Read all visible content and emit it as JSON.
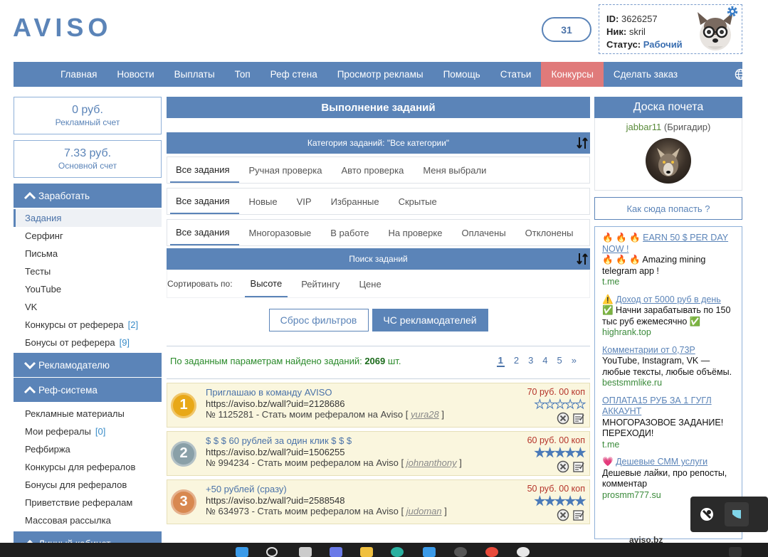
{
  "header": {
    "logo": "AVISO",
    "counter": "31"
  },
  "user": {
    "id_label": "ID:",
    "id": "3626257",
    "nick_label": "Ник:",
    "nick": "skril",
    "status_label": "Статус:",
    "status": "Рабочий"
  },
  "nav": {
    "items": [
      "Главная",
      "Новости",
      "Выплаты",
      "Топ",
      "Реф стена",
      "Просмотр рекламы",
      "Помощь",
      "Статьи",
      "Конкурсы",
      "Сделать заказ"
    ],
    "active": "Конкурсы",
    "active_color": "#e07a7a"
  },
  "accounts": [
    {
      "amount": "0 руб.",
      "label": "Рекламный счет"
    },
    {
      "amount": "7.33 руб.",
      "label": "Основной счет"
    }
  ],
  "sidebar": {
    "earn_title": "Заработать",
    "earn_items": [
      {
        "label": "Задания",
        "count": ""
      },
      {
        "label": "Серфинг",
        "count": ""
      },
      {
        "label": "Письма",
        "count": ""
      },
      {
        "label": "Тесты",
        "count": ""
      },
      {
        "label": "YouTube",
        "count": ""
      },
      {
        "label": "VK",
        "count": ""
      },
      {
        "label": "Конкурсы от реферера",
        "count": "[2]"
      },
      {
        "label": "Бонусы от реферера",
        "count": "[9]"
      }
    ],
    "advertiser_title": "Рекламодателю",
    "ref_title": "Реф-система",
    "ref_items": [
      {
        "label": "Рекламные материалы",
        "count": ""
      },
      {
        "label": "Мои рефералы",
        "count": "[0]"
      },
      {
        "label": "Рефбиржа",
        "count": ""
      },
      {
        "label": "Конкурсы для рефералов",
        "count": ""
      },
      {
        "label": "Бонусы для рефералов",
        "count": ""
      },
      {
        "label": "Приветствие рефералам",
        "count": ""
      },
      {
        "label": "Массовая рассылка",
        "count": ""
      }
    ],
    "cabinet_title": "Личный кабинет"
  },
  "main": {
    "title": "Выполнение заданий",
    "category": "Категория заданий: \"Все категории\"",
    "tabs1": [
      "Все задания",
      "Ручная проверка",
      "Авто проверка",
      "Меня выбрали"
    ],
    "tabs2": [
      "Все задания",
      "Новые",
      "VIP",
      "Избранные",
      "Скрытые"
    ],
    "tabs3": [
      "Все задания",
      "Многоразовые",
      "В работе",
      "На проверке",
      "Оплачены",
      "Отклонены"
    ],
    "search_title": "Поиск заданий",
    "sort_label": "Сортировать по:",
    "sort_tabs": [
      "Высоте",
      "Рейтингу",
      "Цене"
    ],
    "reset_button": "Сброс фильтров",
    "blacklist_button": "ЧС рекламодателей",
    "found_text": "По заданным параметрам найдено заданий:",
    "found_count": "2069",
    "found_unit": "шт.",
    "pages": [
      "1",
      "2",
      "3",
      "4",
      "5",
      "»"
    ],
    "tasks": [
      {
        "rank": "1",
        "medal_color": "#e8a818",
        "title": "Приглашаю в команду AVISO",
        "url": "https://aviso.bz/wall?uid=2128686",
        "number": "№ 1125281",
        "desc": "- Стать моим рефералом на Aviso",
        "author": "yura28",
        "price": "70 руб. 00 коп",
        "rating": 0
      },
      {
        "rank": "2",
        "medal_color": "#8aa0a8",
        "title": "$ $ $ 60 рублей за один клик $ $ $",
        "url": "https://aviso.bz/wall?uid=1506255",
        "number": "№ 994234",
        "desc": "- Стать моим рефералом на Aviso",
        "author": "johnanthony",
        "price": "60 руб. 00 коп",
        "rating": 5
      },
      {
        "rank": "3",
        "medal_color": "#d88850",
        "title": "+50 рублей (сразу)",
        "url": "https://aviso.bz/wall?uid=2588548",
        "number": "№ 634973",
        "desc": "- Стать моим рефералом на Aviso",
        "author": "judoman",
        "price": "50 руб. 00 коп",
        "rating": 5
      }
    ]
  },
  "right": {
    "honor_title": "Доска почета",
    "honor_user": "jabbar11",
    "honor_rank": "(Бригадир)",
    "how_link": "Как сюда попасть ?",
    "ads": [
      {
        "emoji": "🔥 🔥 🔥",
        "head": "EARN 50 $ PER DAY NOW !",
        "body": "🔥 🔥 🔥 Amazing mining telegram app !",
        "link": "t.me"
      },
      {
        "emoji": "⚠️",
        "head": "Доход от 5000 руб в день",
        "body": "✅ Начни зарабатывать по 150 тыс руб ежемесячно ✅",
        "link": "highrank.top"
      },
      {
        "emoji": "",
        "head": "Комментарии от 0,73Р",
        "body": "YouTube, Instagram, VK — любые тексты, любые объёмы.",
        "link": "bestsmmlike.ru"
      },
      {
        "emoji": "",
        "head": "ОПЛАТА15 РУБ ЗА 1 ГУГЛ АККАУНТ",
        "body": "МНОГОРАЗОВОЕ ЗАДАНИЕ! ПЕРЕХОДИ!",
        "link": "t.me"
      },
      {
        "emoji": "💗",
        "head": "Дешевые СММ услуги",
        "body": "Дешевые лайки, про репосты, комментар",
        "link": "prosmm777.su"
      }
    ],
    "footer": "aviso.bz"
  }
}
